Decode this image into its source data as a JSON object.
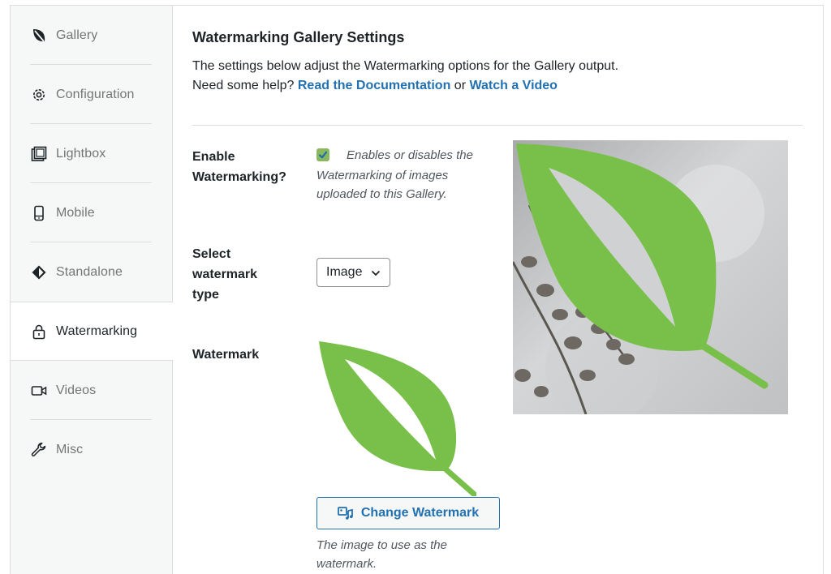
{
  "sidebar": {
    "items": [
      {
        "label": "Gallery",
        "icon": "leaf-icon"
      },
      {
        "label": "Configuration",
        "icon": "gear-icon"
      },
      {
        "label": "Lightbox",
        "icon": "gallery-icon"
      },
      {
        "label": "Mobile",
        "icon": "mobile-icon"
      },
      {
        "label": "Standalone",
        "icon": "diamond-icon"
      },
      {
        "label": "Watermarking",
        "icon": "lock-icon",
        "active": true
      },
      {
        "label": "Videos",
        "icon": "video-icon"
      },
      {
        "label": "Misc",
        "icon": "wrench-icon"
      }
    ]
  },
  "main": {
    "title": "Watermarking Gallery Settings",
    "description": "The settings below adjust the Watermarking options for the Gallery output.",
    "help_prefix": "Need some help?",
    "doc_link": "Read the Documentation",
    "or_text": "or",
    "video_link": "Watch a Video"
  },
  "fields": {
    "enable": {
      "label_line1": "Enable",
      "label_line2": "Watermarking?",
      "checked": true,
      "help_line1": "Enables or disables the",
      "help_line2": "Watermarking of images",
      "help_line3": "uploaded to this Gallery."
    },
    "type": {
      "label_line1": "Select",
      "label_line2": "watermark",
      "label_line3": "type",
      "value": "Image"
    },
    "watermark": {
      "label": "Watermark",
      "button_label": "Change Watermark",
      "help_line1": "The image to use as the",
      "help_line2": "watermark."
    }
  },
  "colors": {
    "accent": "#2271b1",
    "leaf": "#79c04b",
    "checkbox": "#8ab85e"
  }
}
